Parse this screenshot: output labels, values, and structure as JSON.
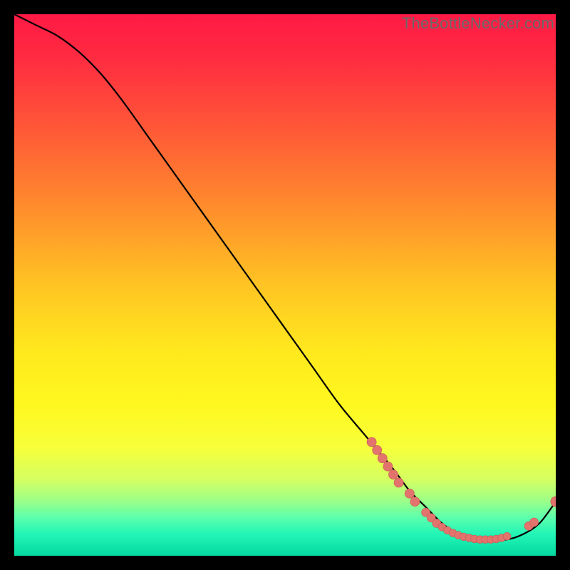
{
  "watermark": "TheBottleNecker.com",
  "colors": {
    "gradient_stops": [
      {
        "offset": 0.0,
        "color": "#ff1a45"
      },
      {
        "offset": 0.08,
        "color": "#ff2b41"
      },
      {
        "offset": 0.2,
        "color": "#ff5438"
      },
      {
        "offset": 0.35,
        "color": "#ff8a2d"
      },
      {
        "offset": 0.5,
        "color": "#ffc423"
      },
      {
        "offset": 0.62,
        "color": "#ffe81e"
      },
      {
        "offset": 0.72,
        "color": "#fff81f"
      },
      {
        "offset": 0.8,
        "color": "#f7ff3a"
      },
      {
        "offset": 0.86,
        "color": "#d4ff63"
      },
      {
        "offset": 0.9,
        "color": "#9aff8a"
      },
      {
        "offset": 0.93,
        "color": "#5bffad"
      },
      {
        "offset": 0.96,
        "color": "#22f5b6"
      },
      {
        "offset": 1.0,
        "color": "#06d9a0"
      }
    ],
    "curve": "#000000",
    "marker_fill": "#e2736d",
    "marker_stroke": "#c95a54"
  },
  "chart_data": {
    "type": "line",
    "title": "",
    "xlabel": "",
    "ylabel": "",
    "xlim": [
      0,
      100
    ],
    "ylim": [
      0,
      100
    ],
    "series": [
      {
        "name": "bottleneck-curve",
        "x": [
          0,
          4,
          8,
          12,
          16,
          20,
          25,
          30,
          35,
          40,
          45,
          50,
          55,
          60,
          65,
          70,
          73,
          76,
          79,
          82,
          85,
          88,
          91,
          94,
          97,
          100
        ],
        "y": [
          100,
          98,
          96,
          93,
          89,
          84,
          77,
          70,
          63,
          56,
          49,
          42,
          35,
          28,
          22,
          16,
          12,
          9,
          6,
          4,
          3,
          3,
          3,
          4,
          6,
          10
        ]
      }
    ],
    "markers": [
      {
        "x": 66,
        "y": 21,
        "r": 1.1
      },
      {
        "x": 67,
        "y": 19.5,
        "r": 1.1
      },
      {
        "x": 68,
        "y": 18,
        "r": 1.1
      },
      {
        "x": 69,
        "y": 16.5,
        "r": 1.1
      },
      {
        "x": 70,
        "y": 15,
        "r": 1.1
      },
      {
        "x": 71,
        "y": 13.5,
        "r": 1.1
      },
      {
        "x": 73,
        "y": 11.5,
        "r": 1.1
      },
      {
        "x": 74,
        "y": 10,
        "r": 1.1
      },
      {
        "x": 76,
        "y": 8,
        "r": 1.0
      },
      {
        "x": 77,
        "y": 7,
        "r": 1.0
      },
      {
        "x": 78,
        "y": 6,
        "r": 1.0
      },
      {
        "x": 79,
        "y": 5.3,
        "r": 0.9
      },
      {
        "x": 80,
        "y": 4.7,
        "r": 0.9
      },
      {
        "x": 81,
        "y": 4.2,
        "r": 0.9
      },
      {
        "x": 82,
        "y": 3.8,
        "r": 0.9
      },
      {
        "x": 83,
        "y": 3.5,
        "r": 0.9
      },
      {
        "x": 84,
        "y": 3.3,
        "r": 0.9
      },
      {
        "x": 85,
        "y": 3.1,
        "r": 0.9
      },
      {
        "x": 86,
        "y": 3.0,
        "r": 0.9
      },
      {
        "x": 87,
        "y": 3.0,
        "r": 0.9
      },
      {
        "x": 88,
        "y": 3.0,
        "r": 0.9
      },
      {
        "x": 89,
        "y": 3.1,
        "r": 0.9
      },
      {
        "x": 90,
        "y": 3.3,
        "r": 0.9
      },
      {
        "x": 91,
        "y": 3.6,
        "r": 0.9
      },
      {
        "x": 95,
        "y": 5.5,
        "r": 1.0
      },
      {
        "x": 96,
        "y": 6.2,
        "r": 1.0
      },
      {
        "x": 100,
        "y": 10,
        "r": 1.2
      }
    ]
  }
}
